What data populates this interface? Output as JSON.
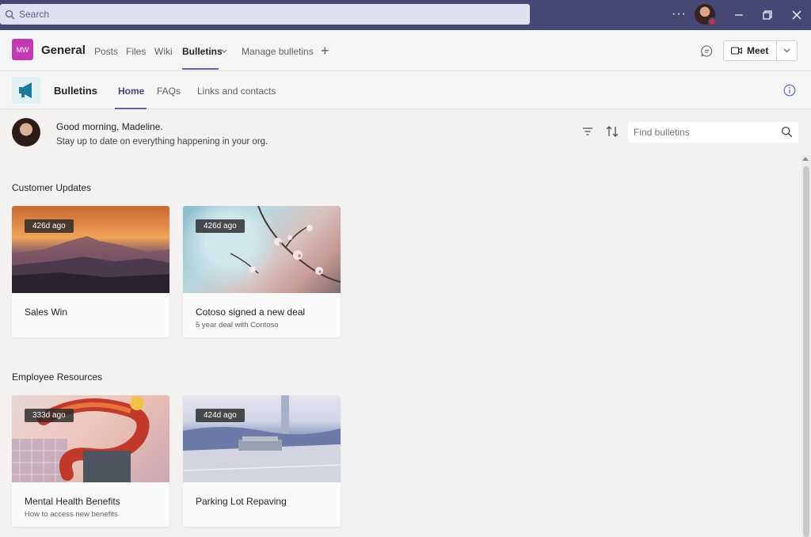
{
  "titlebar": {
    "search_placeholder": "Search",
    "more_label": "···",
    "window_controls": [
      "minimize-icon",
      "restore-icon",
      "close-icon"
    ]
  },
  "channel": {
    "avatar_initials": "MW",
    "name": "General",
    "tabs": [
      {
        "label": "Posts"
      },
      {
        "label": "Files"
      },
      {
        "label": "Wiki"
      },
      {
        "label": "Bulletins",
        "active": true
      },
      {
        "label": "Manage bulletins"
      }
    ],
    "add_tab_label": "+",
    "meet_label": "Meet"
  },
  "app": {
    "title": "Bulletins",
    "tabs": [
      {
        "label": "Home",
        "active": true
      },
      {
        "label": "FAQs"
      },
      {
        "label": "Links and contacts"
      }
    ]
  },
  "greeting": {
    "title": "Good morning, Madeline.",
    "subtitle": "Stay up to date on everything happening in your org.",
    "search_placeholder": "Find bulletins"
  },
  "sections": [
    {
      "title": "Customer Updates",
      "cards": [
        {
          "age": "426d ago",
          "title": "Sales Win",
          "subtitle": ""
        },
        {
          "age": "426d ago",
          "title": "Cotoso signed a new deal",
          "subtitle": "5 year deal with Contoso"
        }
      ]
    },
    {
      "title": "Employee Resources",
      "cards": [
        {
          "age": "333d ago",
          "title": "Mental Health Benefits",
          "subtitle": "How to access new benefits"
        },
        {
          "age": "424d ago",
          "title": "Parking Lot Repaving",
          "subtitle": ""
        }
      ]
    }
  ],
  "colors": {
    "titlebar": "#464775",
    "accent": "#6264a7",
    "avatar_tile": "#c239b3",
    "background": "#f3f2f1"
  }
}
